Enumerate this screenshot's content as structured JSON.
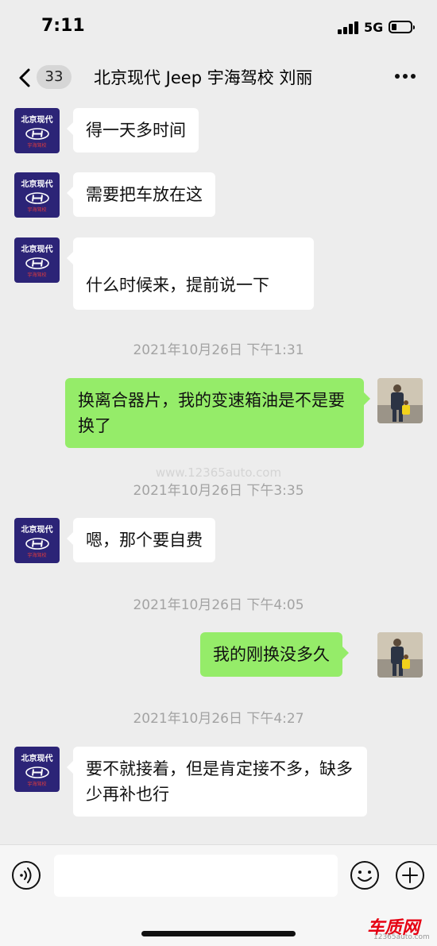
{
  "status_bar": {
    "time": "7:11",
    "network": "5G"
  },
  "nav": {
    "unread_count": "33",
    "title": "北京现代 Jeep 宇海驾校 刘丽"
  },
  "contact_avatar": {
    "brand": "北京现代",
    "sub": "宇海驾校"
  },
  "messages": [
    {
      "side": "left",
      "text": "得一天多时间"
    },
    {
      "side": "left",
      "text": "需要把车放在这"
    },
    {
      "side": "left",
      "text": "什么时候来，提前说一下"
    },
    {
      "type": "time",
      "text": "2021年10月26日 下午1:31"
    },
    {
      "side": "right",
      "text": "换离合器片，我的变速箱油是不是要换了"
    },
    {
      "type": "watermark",
      "text": "www.12365auto.com"
    },
    {
      "type": "time",
      "text": "2021年10月26日 下午3:35"
    },
    {
      "side": "left",
      "text": "嗯，那个要自费"
    },
    {
      "type": "time",
      "text": "2021年10月26日 下午4:05"
    },
    {
      "side": "right",
      "text": "我的刚换没多久"
    },
    {
      "type": "time",
      "text": "2021年10月26日 下午4:27"
    },
    {
      "side": "left",
      "text": "要不就接着，但是肯定接不多，缺多少再补也行"
    }
  ],
  "footer": {
    "site_logo": "车质网",
    "site_url": "12365auto.com"
  },
  "icons": {
    "back": "chevron-left-icon",
    "more": "more-dots-icon",
    "voice": "voice-icon",
    "emoji": "emoji-icon",
    "plus": "plus-icon"
  }
}
